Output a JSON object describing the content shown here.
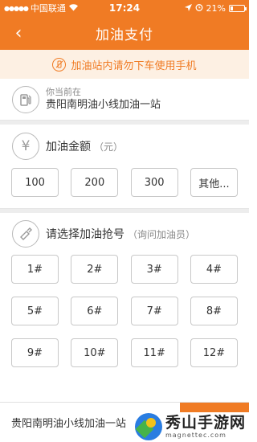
{
  "status_bar": {
    "carrier": "中国联通",
    "time": "17:24",
    "battery_text": "21%",
    "battery_level": 0.21
  },
  "nav": {
    "back_glyph": "‹",
    "title": "加油支付"
  },
  "notice": {
    "text": "加油站内请勿下车使用手机"
  },
  "location": {
    "label": "你当前在",
    "station": "贵阳南明油小线加油一站"
  },
  "amount": {
    "title": "加油金额",
    "hint": "（元）",
    "currency_glyph": "¥",
    "options": [
      "100",
      "200",
      "300",
      "其他..."
    ]
  },
  "nozzle": {
    "title": "请选择加油抢号",
    "hint": "（询问加油员）",
    "options": [
      "1#",
      "2#",
      "3#",
      "4#",
      "5#",
      "6#",
      "7#",
      "8#",
      "9#",
      "10#",
      "11#",
      "12#"
    ]
  },
  "footer": {
    "station": "贵阳南明油小线加油一站"
  },
  "watermark": {
    "main": "秀山手游网",
    "sub": "magnettec.com"
  },
  "colors": {
    "accent": "#f07b24",
    "notice_bg": "#fdf0e3"
  }
}
